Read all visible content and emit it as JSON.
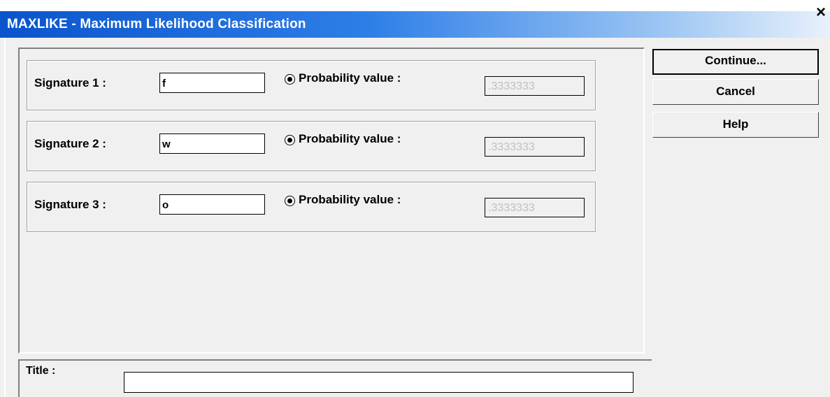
{
  "window": {
    "title": "MAXLIKE - Maximum Likelihood Classification",
    "close_glyph": "×"
  },
  "signatures": [
    {
      "label": "Signature  1 :",
      "value": "f",
      "prob_label": "Probability value :",
      "prob_value": ".3333333",
      "selected": true
    },
    {
      "label": "Signature  2 :",
      "value": "w",
      "prob_label": "Probability value :",
      "prob_value": ".3333333",
      "selected": true
    },
    {
      "label": "Signature  3 :",
      "value": "o",
      "prob_label": "Probability value :",
      "prob_value": ".3333333",
      "selected": true
    }
  ],
  "buttons": {
    "continue": "Continue...",
    "cancel": "Cancel",
    "help": "Help"
  },
  "title_field": {
    "label": "Title :",
    "value": ""
  },
  "colors": {
    "titlebar_start": "#0a54cc",
    "titlebar_end": "#e8f1fb",
    "dialog_bg": "#f0f0f0"
  }
}
